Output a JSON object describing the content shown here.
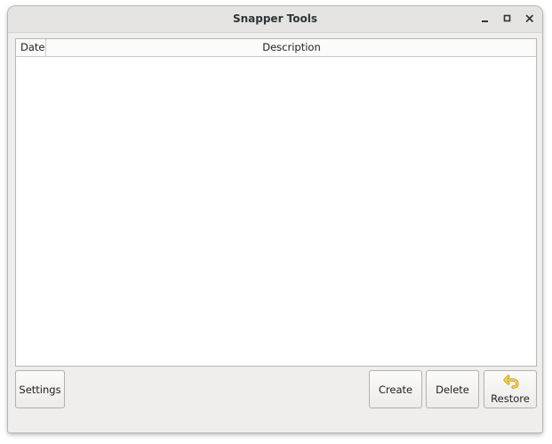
{
  "window": {
    "title": "Snapper Tools",
    "controls": [
      "minimize-icon",
      "maximize-icon",
      "close-icon"
    ]
  },
  "table": {
    "columns": [
      "Date",
      "Description"
    ],
    "rows": []
  },
  "buttons": {
    "settings": "Settings",
    "create": "Create",
    "delete": "Delete",
    "restore": "Restore"
  },
  "icons": {
    "restore": "undo-arrow-icon"
  },
  "colors": {
    "restore_icon": "#e8c43a"
  }
}
